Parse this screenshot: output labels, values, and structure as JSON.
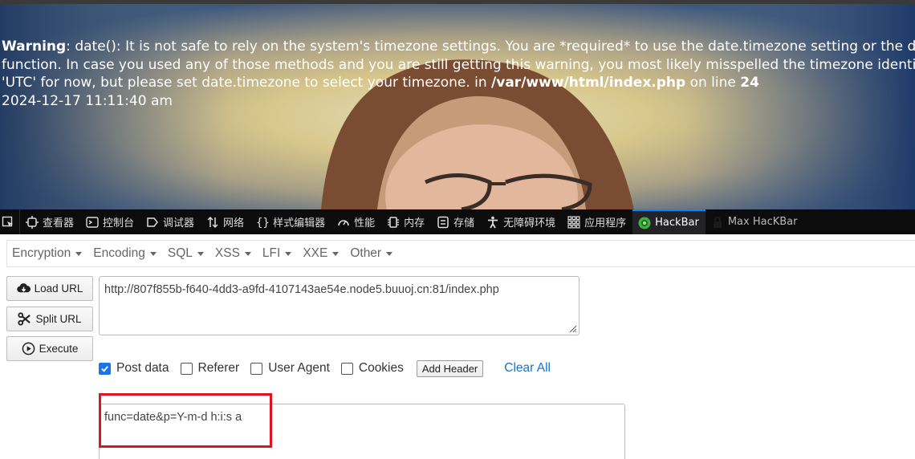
{
  "page": {
    "warning_label": "Warning",
    "warning_line1": ": date(): It is not safe to rely on the system's timezone settings. You are *required* to use the date.timezone setting or the date_de",
    "warning_line2": "function. In case you used any of those methods and you are still getting this warning, you most likely misspelled the timezone identifier. W",
    "warning_line3_prefix": "'UTC' for now, but please set date.timezone to select your timezone. in ",
    "warning_file": "/var/www/html/index.php",
    "warning_on_line": " on line ",
    "warning_line_number": "24",
    "output_datetime": "2024-12-17 11:11:40 am"
  },
  "devtools": {
    "tabs": [
      {
        "label": "查看器",
        "icon": "inspector-icon"
      },
      {
        "label": "控制台",
        "icon": "console-icon"
      },
      {
        "label": "调试器",
        "icon": "debugger-icon"
      },
      {
        "label": "网络",
        "icon": "network-icon"
      },
      {
        "label": "样式编辑器",
        "icon": "style-editor-icon"
      },
      {
        "label": "性能",
        "icon": "performance-icon"
      },
      {
        "label": "内存",
        "icon": "memory-icon"
      },
      {
        "label": "存储",
        "icon": "storage-icon"
      },
      {
        "label": "无障碍环境",
        "icon": "accessibility-icon"
      },
      {
        "label": "应用程序",
        "icon": "application-icon"
      },
      {
        "label": "HackBar",
        "icon": "hackbar-icon"
      },
      {
        "label": "Max HacKBar",
        "icon": "lock-icon"
      }
    ],
    "active_tab": "HackBar",
    "accent_color": "#0a84ff"
  },
  "hackbar": {
    "menus": [
      "Encryption",
      "Encoding",
      "SQL",
      "XSS",
      "LFI",
      "XXE",
      "Other"
    ],
    "load_url_label": "Load URL",
    "split_url_label": "Split URL",
    "execute_label": "Execute",
    "url_value": "http://807f855b-f640-4dd3-a9fd-4107143ae54e.node5.buuoj.cn:81/index.php",
    "options": [
      {
        "label": "Post data",
        "checked": true
      },
      {
        "label": "Referer",
        "checked": false
      },
      {
        "label": "User Agent",
        "checked": false
      },
      {
        "label": "Cookies",
        "checked": false
      }
    ],
    "add_header_label": "Add Header",
    "clear_all_label": "Clear All",
    "post_data_value": "func=date&p=Y-m-d h:i:s a",
    "highlight_color": "#e0141e"
  }
}
